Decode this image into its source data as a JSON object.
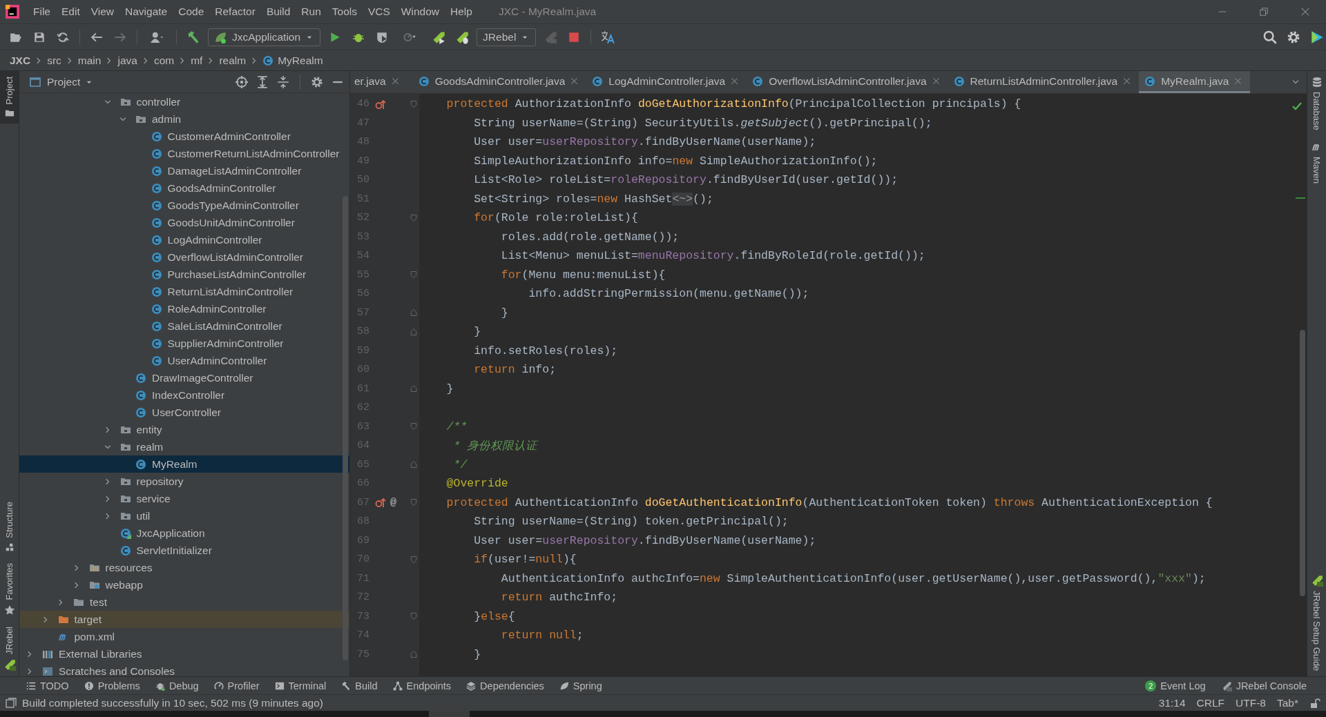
{
  "menu_bar": {
    "items": [
      "File",
      "Edit",
      "View",
      "Navigate",
      "Code",
      "Refactor",
      "Build",
      "Run",
      "Tools",
      "VCS",
      "Window",
      "Help"
    ],
    "window_title": "JXC - MyRealm.java"
  },
  "toolbar": {
    "run_config": "JxcApplication",
    "jrebel_config": "JRebel"
  },
  "breadcrumb": [
    {
      "label": "JXC",
      "kind": "project"
    },
    {
      "label": "src",
      "kind": "folder"
    },
    {
      "label": "main",
      "kind": "folder"
    },
    {
      "label": "java",
      "kind": "folder"
    },
    {
      "label": "com",
      "kind": "folder"
    },
    {
      "label": "mf",
      "kind": "folder"
    },
    {
      "label": "realm",
      "kind": "folder"
    },
    {
      "label": "MyRealm",
      "kind": "class"
    }
  ],
  "left_strip": {
    "top": [
      {
        "label": "Project",
        "kind": "project",
        "selected": true
      }
    ],
    "bottom": [
      {
        "label": "Structure",
        "kind": "structure",
        "selected": false
      },
      {
        "label": "Favorites",
        "kind": "favorites",
        "selected": false
      },
      {
        "label": "JRebel",
        "kind": "jrebel",
        "selected": false
      }
    ]
  },
  "project_panel": {
    "title": "Project",
    "tree": [
      {
        "children": [
          {
            "children": [
              {
                "children": [
                  {
                    "children": [
                      {
                        "children": [
                          {
                            "label": "controller",
                            "kind": "package",
                            "expanded": true,
                            "selected": false,
                            "children": [
                              {
                                "label": "admin",
                                "kind": "package",
                                "expanded": true,
                                "selected": false,
                                "children": [
                                  {
                                    "label": "CustomerAdminController",
                                    "kind": "class",
                                    "selected": false
                                  },
                                  {
                                    "label": "CustomerReturnListAdminController",
                                    "kind": "class",
                                    "selected": false
                                  },
                                  {
                                    "label": "DamageListAdminController",
                                    "kind": "class",
                                    "selected": false
                                  },
                                  {
                                    "label": "GoodsAdminController",
                                    "kind": "class",
                                    "selected": false
                                  },
                                  {
                                    "label": "GoodsTypeAdminController",
                                    "kind": "class",
                                    "selected": false
                                  },
                                  {
                                    "label": "GoodsUnitAdminController",
                                    "kind": "class",
                                    "selected": false
                                  },
                                  {
                                    "label": "LogAdminController",
                                    "kind": "class",
                                    "selected": false
                                  },
                                  {
                                    "label": "OverflowListAdminController",
                                    "kind": "class",
                                    "selected": false
                                  },
                                  {
                                    "label": "PurchaseListAdminController",
                                    "kind": "class",
                                    "selected": false
                                  },
                                  {
                                    "label": "ReturnListAdminController",
                                    "kind": "class",
                                    "selected": false
                                  },
                                  {
                                    "label": "RoleAdminController",
                                    "kind": "class",
                                    "selected": false
                                  },
                                  {
                                    "label": "SaleListAdminController",
                                    "kind": "class",
                                    "selected": false
                                  },
                                  {
                                    "label": "SupplierAdminController",
                                    "kind": "class",
                                    "selected": false
                                  },
                                  {
                                    "label": "UserAdminController",
                                    "kind": "class",
                                    "selected": false
                                  }
                                ]
                              },
                              {
                                "label": "DrawImageController",
                                "kind": "class",
                                "selected": false
                              },
                              {
                                "label": "IndexController",
                                "kind": "class",
                                "selected": false
                              },
                              {
                                "label": "UserController",
                                "kind": "class",
                                "selected": false
                              }
                            ]
                          },
                          {
                            "label": "entity",
                            "kind": "package",
                            "expanded": false,
                            "selected": false
                          },
                          {
                            "label": "realm",
                            "kind": "package",
                            "expanded": true,
                            "selected": false,
                            "children": [
                              {
                                "label": "MyRealm",
                                "kind": "class",
                                "selected": true
                              }
                            ]
                          },
                          {
                            "label": "repository",
                            "kind": "package",
                            "expanded": false,
                            "selected": false
                          },
                          {
                            "label": "service",
                            "kind": "package",
                            "expanded": false,
                            "selected": false
                          },
                          {
                            "label": "util",
                            "kind": "package",
                            "expanded": false,
                            "selected": false
                          },
                          {
                            "label": "JxcApplication",
                            "kind": "app-class",
                            "selected": false
                          },
                          {
                            "label": "ServletInitializer",
                            "kind": "class",
                            "selected": false
                          }
                        ]
                      }
                    ]
                  },
                  {
                    "label": "resources",
                    "kind": "resources",
                    "expanded": false,
                    "selected": false
                  },
                  {
                    "label": "webapp",
                    "kind": "web",
                    "expanded": false,
                    "selected": false
                  }
                ]
              },
              {
                "label": "test",
                "kind": "folder",
                "expanded": false,
                "selected": false
              }
            ]
          },
          {
            "label": "target",
            "kind": "excluded",
            "expanded": false,
            "selected": false
          },
          {
            "label": "pom.xml",
            "kind": "maven",
            "selected": false
          }
        ]
      },
      {
        "label": "External Libraries",
        "kind": "libraries",
        "expanded": false,
        "selected": false
      },
      {
        "label": "Scratches and Consoles",
        "kind": "scratches",
        "expanded": false,
        "selected": false
      }
    ]
  },
  "editor_tabs": [
    {
      "label": "er.java",
      "kind": "plain",
      "selected": false
    },
    {
      "label": "GoodsAdminController.java",
      "kind": "class",
      "selected": false
    },
    {
      "label": "LogAdminController.java",
      "kind": "class",
      "selected": false
    },
    {
      "label": "OverflowListAdminController.java",
      "kind": "class",
      "selected": false
    },
    {
      "label": "ReturnListAdminController.java",
      "kind": "class",
      "selected": false
    },
    {
      "label": "MyRealm.java",
      "kind": "class",
      "selected": true
    }
  ],
  "code_lines": [
    {
      "number": "46",
      "fold": {
        "kind": "start"
      },
      "markers": [
        {
          "kind": "override"
        }
      ],
      "tokens": [
        {
          "kind": "keyword",
          "text": "    protected"
        },
        {
          "kind": "plain",
          "text": " AuthorizationInfo "
        },
        {
          "kind": "method",
          "text": "doGetAuthorizationInfo"
        },
        {
          "kind": "plain",
          "text": "(PrincipalCollection principals) {"
        }
      ]
    },
    {
      "number": "47",
      "tokens": [
        {
          "kind": "plain",
          "text": "        String userName=(String) SecurityUtils."
        },
        {
          "kind": "static",
          "text": "getSubject"
        },
        {
          "kind": "plain",
          "text": "().getPrincipal();"
        }
      ]
    },
    {
      "number": "48",
      "tokens": [
        {
          "kind": "plain",
          "text": "        User user="
        },
        {
          "kind": "field",
          "text": "userRepository"
        },
        {
          "kind": "plain",
          "text": ".findByUserName(userName);"
        }
      ]
    },
    {
      "number": "49",
      "tokens": [
        {
          "kind": "plain",
          "text": "        SimpleAuthorizationInfo info="
        },
        {
          "kind": "keyword",
          "text": "new"
        },
        {
          "kind": "plain",
          "text": " SimpleAuthorizationInfo();"
        }
      ]
    },
    {
      "number": "50",
      "tokens": [
        {
          "kind": "plain",
          "text": "        List<Role> roleList="
        },
        {
          "kind": "field",
          "text": "roleRepository"
        },
        {
          "kind": "plain",
          "text": ".findByUserId(user.getId());"
        }
      ]
    },
    {
      "number": "51",
      "tokens": [
        {
          "kind": "plain",
          "text": "        Set<String> roles="
        },
        {
          "kind": "keyword",
          "text": "new"
        },
        {
          "kind": "plain",
          "text": " HashSet"
        },
        {
          "kind": "folded",
          "text": "<~>"
        },
        {
          "kind": "plain",
          "text": "();"
        }
      ]
    },
    {
      "number": "52",
      "fold": {
        "kind": "start"
      },
      "tokens": [
        {
          "kind": "keyword",
          "text": "        for"
        },
        {
          "kind": "plain",
          "text": "(Role role:roleList){"
        }
      ]
    },
    {
      "number": "53",
      "tokens": [
        {
          "kind": "plain",
          "text": "            roles.add(role.getName());"
        }
      ]
    },
    {
      "number": "54",
      "tokens": [
        {
          "kind": "plain",
          "text": "            List<Menu> menuList="
        },
        {
          "kind": "field",
          "text": "menuRepository"
        },
        {
          "kind": "plain",
          "text": ".findByRoleId(role.getId());"
        }
      ]
    },
    {
      "number": "55",
      "fold": {
        "kind": "start"
      },
      "tokens": [
        {
          "kind": "keyword",
          "text": "            for"
        },
        {
          "kind": "plain",
          "text": "(Menu menu:menuList){"
        }
      ]
    },
    {
      "number": "56",
      "tokens": [
        {
          "kind": "plain",
          "text": "                info.addStringPermission(menu.getName());"
        }
      ]
    },
    {
      "number": "57",
      "fold": {
        "kind": "end"
      },
      "tokens": [
        {
          "kind": "plain",
          "text": "            }"
        }
      ]
    },
    {
      "number": "58",
      "fold": {
        "kind": "end"
      },
      "tokens": [
        {
          "kind": "plain",
          "text": "        }"
        }
      ]
    },
    {
      "number": "59",
      "tokens": [
        {
          "kind": "plain",
          "text": "        info.setRoles(roles);"
        }
      ]
    },
    {
      "number": "60",
      "tokens": [
        {
          "kind": "keyword",
          "text": "        return"
        },
        {
          "kind": "plain",
          "text": " info;"
        }
      ]
    },
    {
      "number": "61",
      "fold": {
        "kind": "end"
      },
      "tokens": [
        {
          "kind": "plain",
          "text": "    }"
        }
      ]
    },
    {
      "number": "62"
    },
    {
      "number": "63",
      "fold": {
        "kind": "start"
      },
      "tokens": [
        {
          "kind": "comment",
          "text": "    /**"
        }
      ]
    },
    {
      "number": "64",
      "tokens": [
        {
          "kind": "comment",
          "text": "     * 身份权限认证"
        }
      ]
    },
    {
      "number": "65",
      "fold": {
        "kind": "end"
      },
      "tokens": [
        {
          "kind": "comment",
          "text": "     */"
        }
      ]
    },
    {
      "number": "66",
      "tokens": [
        {
          "kind": "annotation",
          "text": "    @Override"
        }
      ]
    },
    {
      "number": "67",
      "fold": {
        "kind": "start"
      },
      "markers": [
        {
          "kind": "override"
        },
        {
          "kind": "annotation",
          "symbol": "@"
        }
      ],
      "tokens": [
        {
          "kind": "keyword",
          "text": "    protected"
        },
        {
          "kind": "plain",
          "text": " AuthenticationInfo "
        },
        {
          "kind": "method",
          "text": "doGetAuthenticationInfo"
        },
        {
          "kind": "plain",
          "text": "(AuthenticationToken token) "
        },
        {
          "kind": "keyword",
          "text": "throws"
        },
        {
          "kind": "plain",
          "text": " AuthenticationException {"
        }
      ]
    },
    {
      "number": "68",
      "tokens": [
        {
          "kind": "plain",
          "text": "        String userName=(String) token.getPrincipal();"
        }
      ]
    },
    {
      "number": "69",
      "tokens": [
        {
          "kind": "plain",
          "text": "        User user="
        },
        {
          "kind": "field",
          "text": "userRepository"
        },
        {
          "kind": "plain",
          "text": ".findByUserName(userName);"
        }
      ]
    },
    {
      "number": "70",
      "fold": {
        "kind": "start"
      },
      "tokens": [
        {
          "kind": "keyword",
          "text": "        if"
        },
        {
          "kind": "plain",
          "text": "(user!="
        },
        {
          "kind": "keyword",
          "text": "null"
        },
        {
          "kind": "plain",
          "text": "){"
        }
      ]
    },
    {
      "number": "71",
      "tokens": [
        {
          "kind": "plain",
          "text": "            AuthenticationInfo authcInfo="
        },
        {
          "kind": "keyword",
          "text": "new"
        },
        {
          "kind": "plain",
          "text": " SimpleAuthenticationInfo(user.getUserName(),user.getPassword(),"
        },
        {
          "kind": "string",
          "text": "\"xxx\""
        },
        {
          "kind": "plain",
          "text": ");"
        }
      ]
    },
    {
      "number": "72",
      "tokens": [
        {
          "kind": "keyword",
          "text": "            return"
        },
        {
          "kind": "plain",
          "text": " authcInfo;"
        }
      ]
    },
    {
      "number": "73",
      "fold": {
        "kind": "start"
      },
      "tokens": [
        {
          "kind": "plain",
          "text": "        }"
        },
        {
          "kind": "keyword",
          "text": "else"
        },
        {
          "kind": "plain",
          "text": "{"
        }
      ]
    },
    {
      "number": "74",
      "tokens": [
        {
          "kind": "keyword",
          "text": "            return null"
        },
        {
          "kind": "plain",
          "text": ";"
        }
      ]
    },
    {
      "number": "75",
      "fold": {
        "kind": "end"
      },
      "tokens": [
        {
          "kind": "plain",
          "text": "        }"
        }
      ]
    }
  ],
  "right_strip": {
    "top": [
      {
        "label": "Database",
        "kind": "database"
      },
      {
        "label": "Maven",
        "kind": "maven"
      }
    ],
    "bottom": [
      {
        "label": "JRebel Setup Guide",
        "kind": "jrebel"
      }
    ]
  },
  "tool_windows": {
    "left": [
      {
        "label": "TODO",
        "kind": "todo"
      },
      {
        "label": "Problems",
        "kind": "problems"
      },
      {
        "label": "Debug",
        "kind": "debug"
      },
      {
        "label": "Profiler",
        "kind": "profiler"
      },
      {
        "label": "Terminal",
        "kind": "terminal"
      },
      {
        "label": "Build",
        "kind": "build"
      },
      {
        "label": "Endpoints",
        "kind": "endpoints"
      },
      {
        "label": "Dependencies",
        "kind": "dependencies"
      },
      {
        "label": "Spring",
        "kind": "spring"
      }
    ],
    "right": [
      {
        "label": "Event Log",
        "kind": "event-log",
        "badge": "2"
      },
      {
        "label": "JRebel Console",
        "kind": "jrebel"
      }
    ]
  },
  "status_bar": {
    "message": "Build completed successfully in 10 sec, 502 ms (9 minutes ago)",
    "items": [
      "31:14",
      "CRLF",
      "UTF-8",
      "Tab*"
    ]
  }
}
